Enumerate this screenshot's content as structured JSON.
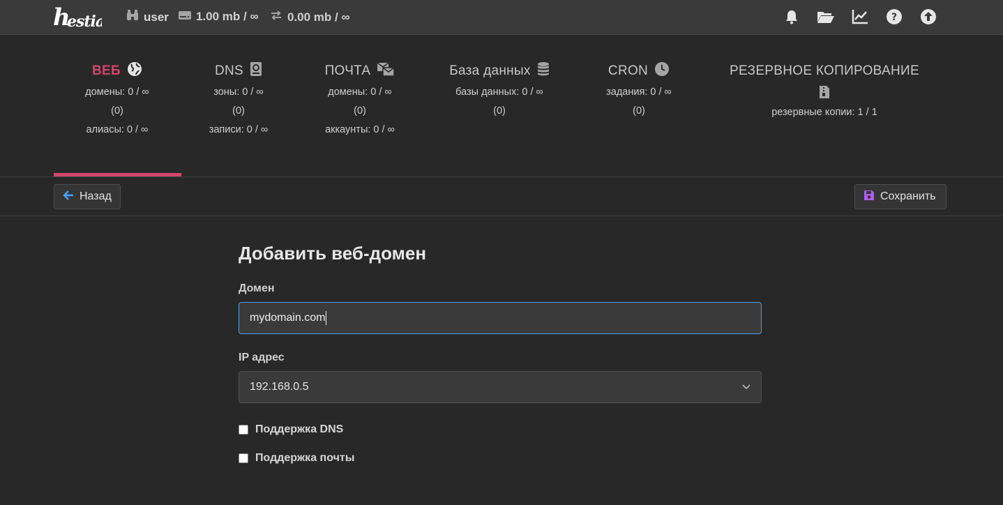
{
  "topbar": {
    "logo": "hestia",
    "user": "user",
    "disk": "1.00 mb / ∞",
    "bandwidth": "0.00 mb / ∞",
    "icons": [
      "bell-icon",
      "folder-icon",
      "chart-icon",
      "help-icon",
      "update-icon"
    ]
  },
  "tabs": [
    {
      "label": "ВЕБ",
      "icon": "globe-icon",
      "lines": [
        "домены: 0 / ∞",
        "(0)",
        "алиасы: 0 / ∞"
      ]
    },
    {
      "label": "DNS",
      "icon": "book-icon",
      "lines": [
        "зоны: 0 / ∞",
        "(0)",
        "записи: 0 / ∞"
      ]
    },
    {
      "label": "ПОЧТА",
      "icon": "mail-icon",
      "lines": [
        "домены: 0 / ∞",
        "(0)",
        "аккаунты: 0 / ∞"
      ]
    },
    {
      "label": "База данных",
      "icon": "database-icon",
      "lines": [
        "базы данных: 0 / ∞",
        "(0)"
      ]
    },
    {
      "label": "CRON",
      "icon": "clock-icon",
      "lines": [
        "задания: 0 / ∞",
        "(0)"
      ]
    },
    {
      "label": "РЕЗЕРВНОЕ КОПИРОВАНИЕ",
      "icon": "archive-icon",
      "lines": [
        "резервные копии: 1 / 1"
      ]
    }
  ],
  "toolbar": {
    "back_label": "Назад",
    "save_label": "Сохранить"
  },
  "form": {
    "title": "Добавить веб-домен",
    "domain_label": "Домен",
    "domain_value": "mydomain.com",
    "ip_label": "IP адрес",
    "ip_value": "192.168.0.5",
    "dns_support_label": "Поддержка DNS",
    "mail_support_label": "Поддержка почты"
  },
  "colors": {
    "accent": "#d2466e",
    "focus": "#4d9ee8",
    "back_arrow": "#4aa3ff",
    "save_icon": "#b05cf0"
  }
}
